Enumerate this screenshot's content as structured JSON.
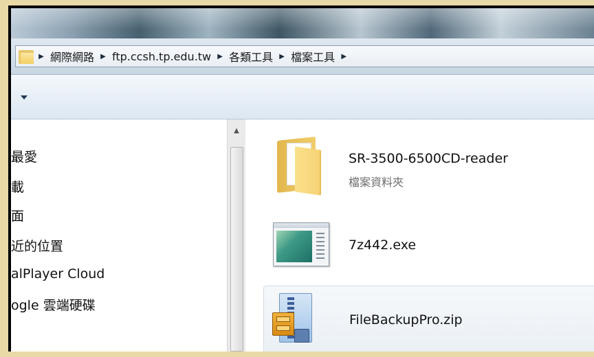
{
  "address_bar": {
    "breadcrumbs": [
      "網際網路",
      "ftp.ccsh.tp.edu.tw",
      "各類工具",
      "檔案工具"
    ],
    "icon": "folder-icon",
    "separator_icon": "chevron-right-icon"
  },
  "toolbar": {
    "dropdown_icon": "chevron-down-icon"
  },
  "navigation": {
    "items": [
      {
        "label": "最愛"
      },
      {
        "label": "載"
      },
      {
        "label": "面"
      },
      {
        "label": "近的位置"
      },
      {
        "label": "alPlayer Cloud"
      },
      {
        "label": "ogle 雲端硬碟"
      }
    ]
  },
  "files": [
    {
      "name": "SR-3500-6500CD-reader",
      "type": "檔案資料夾",
      "icon": "folder-icon"
    },
    {
      "name": "7z442.exe",
      "icon": "exe-icon"
    },
    {
      "name": "FileBackupPro.zip",
      "icon": "zip-icon"
    }
  ],
  "colors": {
    "background": "#e9d9a6",
    "frame": "#000000",
    "address_bar": "#dfe8f0",
    "selected_item": "#ebf0f5"
  }
}
